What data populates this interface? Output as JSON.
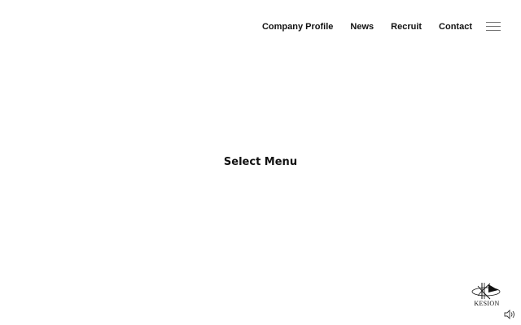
{
  "nav": {
    "items": [
      {
        "label": "Company Profile"
      },
      {
        "label": "News"
      },
      {
        "label": "Recruit"
      },
      {
        "label": "Contact"
      }
    ]
  },
  "main": {
    "title": "Select Menu"
  },
  "logo": {
    "text": "KESION"
  },
  "icons": {
    "menu": "hamburger-menu-icon",
    "sound": "sound-toggle-icon"
  }
}
